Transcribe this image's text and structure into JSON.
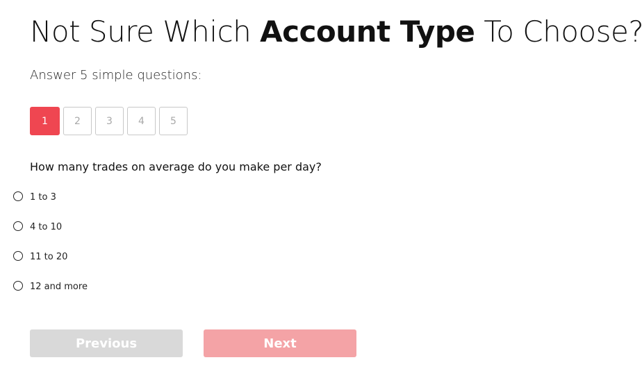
{
  "header": {
    "title_part1": "Not Sure Which ",
    "title_bold": "Account Type",
    "title_part2": " To Choose?",
    "subtitle": "Answer 5 simple questions:"
  },
  "steps": {
    "current": 1,
    "items": [
      {
        "label": "1",
        "active": true
      },
      {
        "label": "2",
        "active": false
      },
      {
        "label": "3",
        "active": false
      },
      {
        "label": "4",
        "active": false
      },
      {
        "label": "5",
        "active": false
      }
    ]
  },
  "question": {
    "text": "How many trades on average do you make per day?",
    "options": [
      {
        "label": "1 to 3",
        "selected": false
      },
      {
        "label": "4 to 10",
        "selected": false
      },
      {
        "label": "11 to 20",
        "selected": false
      },
      {
        "label": "12 and more",
        "selected": false
      }
    ]
  },
  "buttons": {
    "previous_label": "Previous",
    "next_label": "Next"
  },
  "colors": {
    "accent": "#ef4651",
    "next_disabled": "#f4a3a6",
    "previous_disabled": "#d9d9d9"
  }
}
